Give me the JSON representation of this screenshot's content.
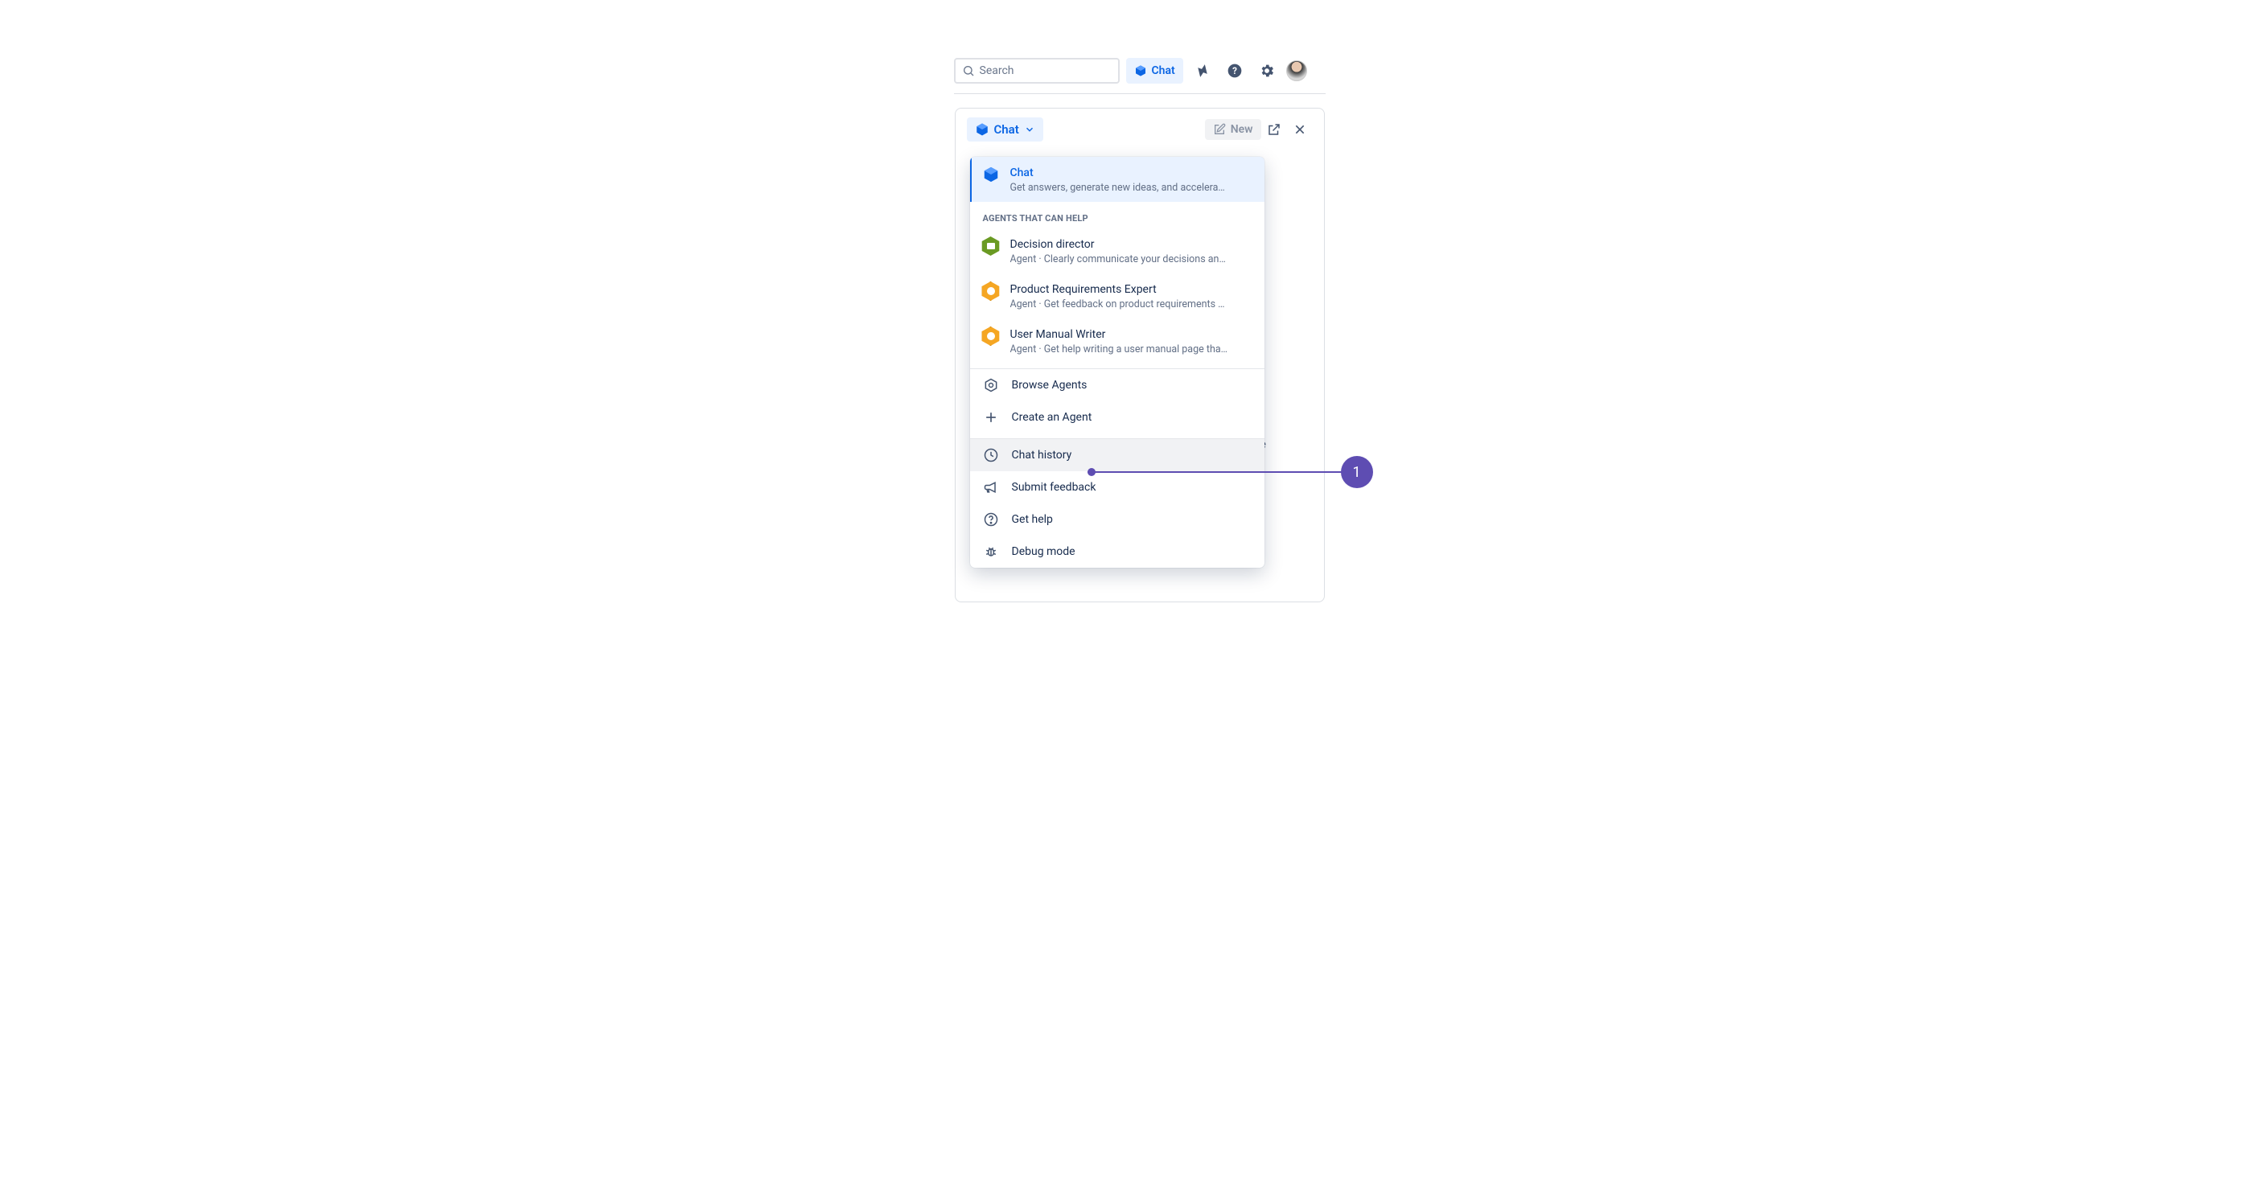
{
  "topbar": {
    "search_placeholder": "Search",
    "chat_label": "Chat"
  },
  "panel": {
    "chat_dropdown_label": "Chat",
    "new_label": "New",
    "behind_text_fragment": "e"
  },
  "dropdown": {
    "primary": {
      "title": "Chat",
      "subtitle": "Get answers, generate new ideas, and accelera…"
    },
    "agents_label": "AGENTS THAT CAN HELP",
    "agents": [
      {
        "title": "Decision director",
        "subtitle": "Agent · Clearly communicate your decisions an…"
      },
      {
        "title": "Product Requirements Expert",
        "subtitle": "Agent · Get feedback on product requirements …"
      },
      {
        "title": "User Manual Writer",
        "subtitle": "Agent · Get help writing a user manual page tha…"
      }
    ],
    "actions": {
      "browse": "Browse Agents",
      "create": "Create an Agent"
    },
    "footer": {
      "history": "Chat history",
      "feedback": "Submit feedback",
      "help": "Get help",
      "debug": "Debug mode"
    }
  },
  "callout": {
    "number": "1"
  }
}
